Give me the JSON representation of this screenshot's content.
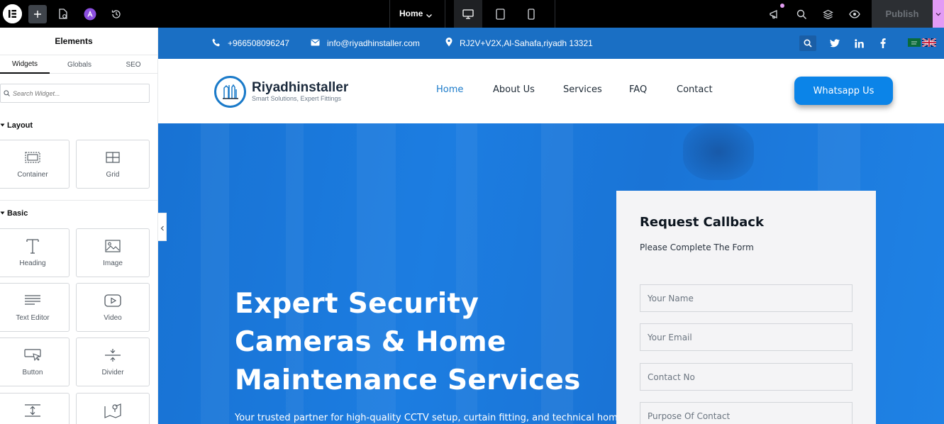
{
  "editor": {
    "page_selector": "Home",
    "publish_label": "Publish",
    "icons": {
      "logo": "elementor-logo-icon",
      "add": "plus-icon",
      "page_settings": "page-settings-icon",
      "ai": "ai-icon",
      "history": "history-icon",
      "desktop": "desktop-icon",
      "tablet": "tablet-icon",
      "mobile": "mobile-icon",
      "notifications": "megaphone-icon",
      "search": "search-icon",
      "structure": "layers-icon",
      "preview": "eye-icon"
    }
  },
  "panel": {
    "title": "Elements",
    "tabs": [
      "Widgets",
      "Globals",
      "SEO"
    ],
    "search_placeholder": "Search Widget...",
    "categories": {
      "layout": {
        "title": "Layout",
        "widgets": [
          {
            "label": "Container",
            "icon": "container-icon"
          },
          {
            "label": "Grid",
            "icon": "grid-icon"
          }
        ]
      },
      "basic": {
        "title": "Basic",
        "widgets": [
          {
            "label": "Heading",
            "icon": "heading-icon"
          },
          {
            "label": "Image",
            "icon": "image-icon"
          },
          {
            "label": "Text Editor",
            "icon": "text-editor-icon"
          },
          {
            "label": "Video",
            "icon": "video-icon"
          },
          {
            "label": "Button",
            "icon": "button-icon"
          },
          {
            "label": "Divider",
            "icon": "divider-icon"
          }
        ]
      }
    }
  },
  "site": {
    "colors": {
      "primary": "#1a6fc4",
      "accent": "#0b84e8",
      "nav_active": "#1a7ac9"
    },
    "topbar": {
      "phone": "+966508096247",
      "email": "info@riyadhinstaller.com",
      "address": "RJ2V+V2X,Al-Sahafa,riyadh 13321"
    },
    "logo": {
      "name": "Riyadhinstaller",
      "tagline": "Smart Solutions, Expert Fittings"
    },
    "nav": [
      "Home",
      "About Us",
      "Services",
      "FAQ",
      "Contact"
    ],
    "cta": "Whatsapp Us",
    "hero": {
      "title": "Expert Security Cameras & Home Maintenance Services",
      "subtitle": "Your trusted partner for high-quality CCTV setup, curtain fitting, and technical home"
    },
    "form": {
      "title": "Request Callback",
      "description": "Please Complete The Form",
      "fields": [
        "Your Name",
        "Your Email",
        "Contact No",
        "Purpose Of Contact"
      ]
    }
  }
}
